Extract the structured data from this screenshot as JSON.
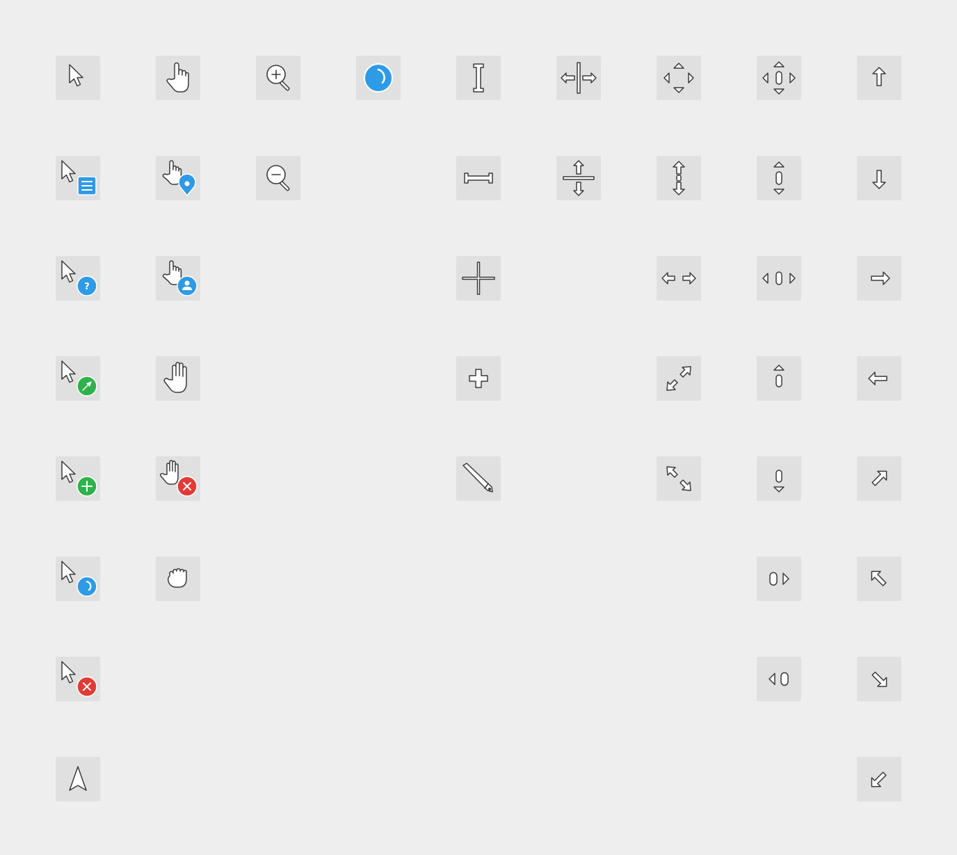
{
  "cursor_grid": {
    "background": "#eeeeee",
    "tile_color": "#e0e0e0",
    "badge_colors": {
      "blue": "#2f9ae6",
      "green": "#2fb24c",
      "red": "#e23b36"
    },
    "help_badge_glyph": "?",
    "cursors": [
      "arrow-cursor-icon",
      "context-menu-cursor-icon",
      "help-cursor-icon",
      "alias-cursor-icon",
      "copy-cursor-icon",
      "progress-cursor-icon",
      "not-allowed-cursor-icon",
      "center-arrow-cursor-icon",
      "pointer-hand-cursor-icon",
      "location-hand-cursor-icon",
      "person-hand-cursor-icon",
      "open-hand-cursor-icon",
      "no-drop-hand-cursor-icon",
      "grabbing-cursor-icon",
      "zoom-in-cursor-icon",
      "zoom-out-cursor-icon",
      "wait-spinner-cursor-icon",
      "text-beam-cursor-icon",
      "vertical-text-cursor-icon",
      "crosshair-cursor-icon",
      "cell-cursor-icon",
      "pencil-cursor-icon",
      "col-resize-cursor-icon",
      "row-resize-cursor-icon",
      "move-cursor-icon",
      "ns-resize-cursor-icon",
      "ew-resize-cursor-icon",
      "nesw-resize-cursor-icon",
      "nwse-resize-cursor-icon",
      "all-scroll-cursor-icon",
      "ns-scroll-cursor-icon",
      "ew-scroll-cursor-icon",
      "n-scroll-cursor-icon",
      "s-scroll-cursor-icon",
      "e-scroll-cursor-icon",
      "w-scroll-cursor-icon",
      "n-resize-cursor-icon",
      "s-resize-cursor-icon",
      "e-resize-cursor-icon",
      "w-resize-cursor-icon",
      "ne-resize-cursor-icon",
      "nw-resize-cursor-icon",
      "se-resize-cursor-icon",
      "sw-resize-cursor-icon"
    ]
  }
}
